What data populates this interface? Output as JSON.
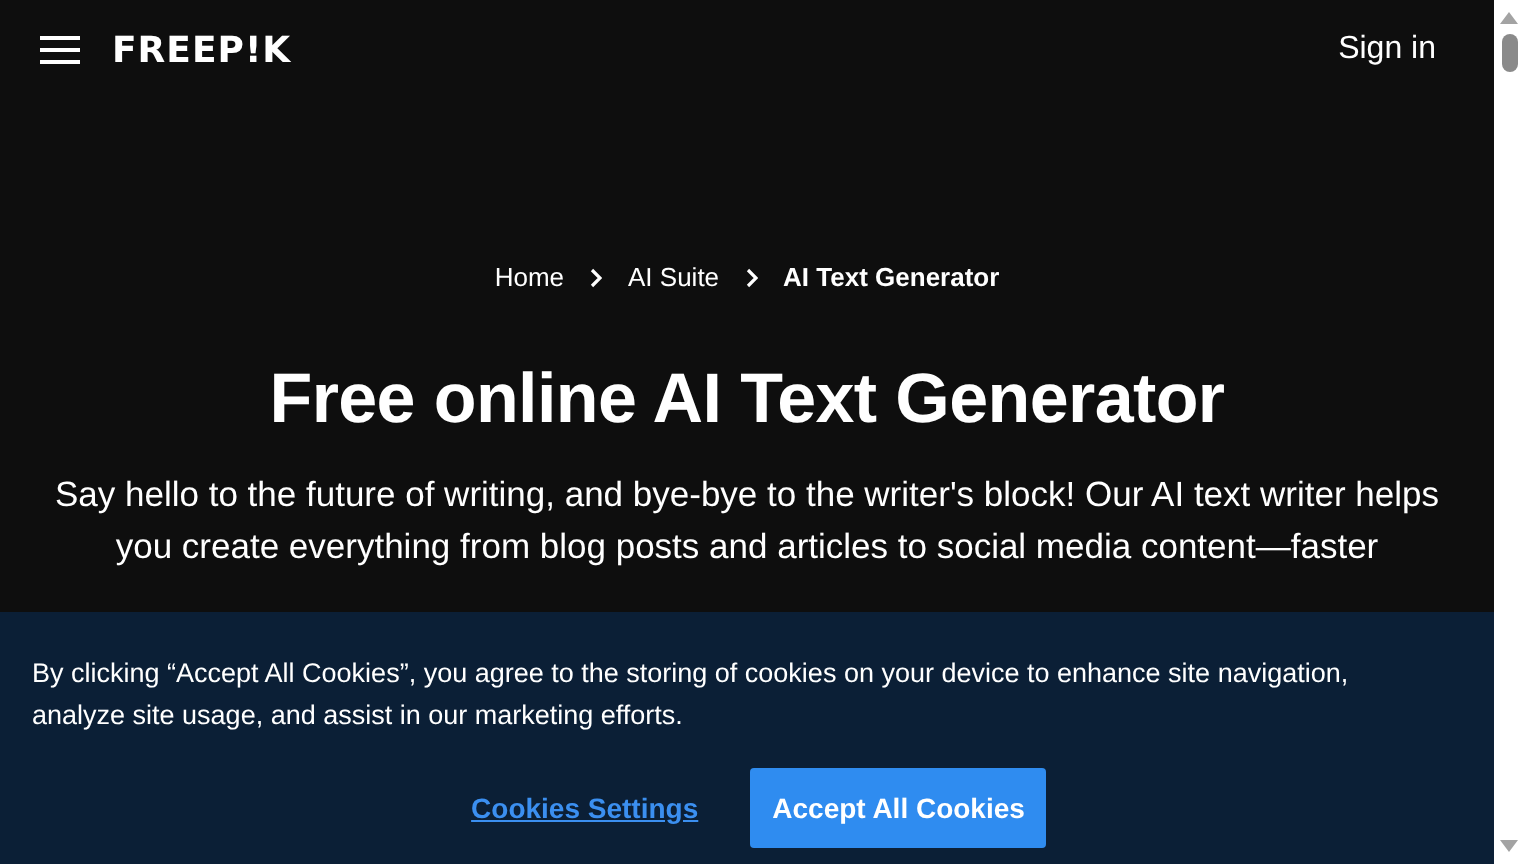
{
  "header": {
    "logo": "FREEP!K",
    "sign_in": "Sign in"
  },
  "breadcrumb": [
    {
      "label": "Home",
      "current": false
    },
    {
      "label": "AI Suite",
      "current": false
    },
    {
      "label": "AI Text Generator",
      "current": true
    }
  ],
  "title": "Free online AI Text Generator",
  "intro": "Say hello to the future of writing, and bye-bye to the writer's block! Our AI text writer helps you create everything from blog posts and articles to social media content—faster",
  "cookie_banner": {
    "message": "By clicking “Accept All Cookies”, you agree to the storing of cookies on your device to enhance site navigation, analyze site usage, and assist in our marketing efforts.",
    "settings_link": "Cookies Settings",
    "accept_button": "Accept All Cookies"
  }
}
